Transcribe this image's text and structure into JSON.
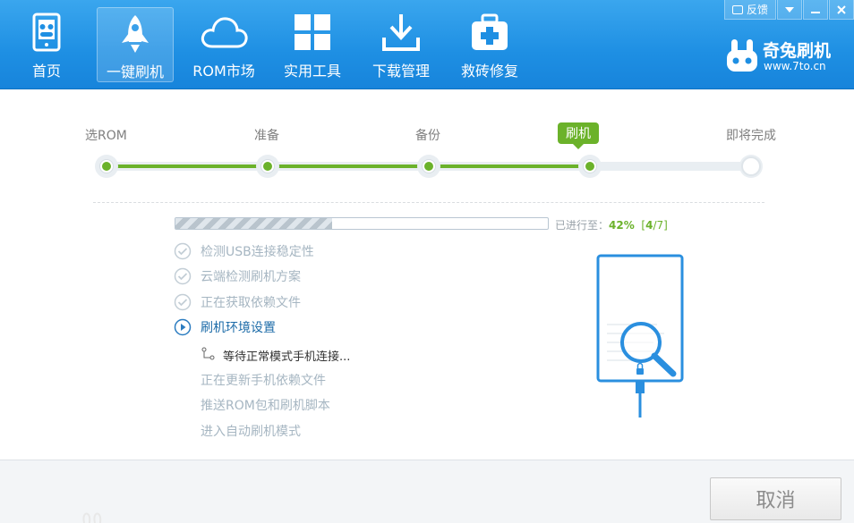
{
  "nav": {
    "items": [
      {
        "label": "首页",
        "icon": "home-icon"
      },
      {
        "label": "一键刷机",
        "icon": "rocket-icon",
        "active": true
      },
      {
        "label": "ROM市场",
        "icon": "cloud-icon"
      },
      {
        "label": "实用工具",
        "icon": "grid-icon"
      },
      {
        "label": "下载管理",
        "icon": "download-icon"
      },
      {
        "label": "救砖修复",
        "icon": "medical-kit-icon"
      }
    ]
  },
  "window_controls": {
    "feedback_label": "反馈"
  },
  "brand": {
    "name": "奇兔刷机",
    "url": "www.7to.cn"
  },
  "steps": {
    "items": [
      {
        "label": "选ROM",
        "state": "done"
      },
      {
        "label": "准备",
        "state": "done"
      },
      {
        "label": "备份",
        "state": "done"
      },
      {
        "label": "刷机",
        "state": "current"
      },
      {
        "label": "即将完成",
        "state": "pending"
      }
    ]
  },
  "progress": {
    "prefix": "已进行至：",
    "percent_text": "42%",
    "value": 0.42,
    "count_open": "[",
    "count_current": "4",
    "count_sep": "/",
    "count_total": "7",
    "count_close": "]"
  },
  "tasks": [
    {
      "label": "检测USB连接稳定性",
      "state": "done"
    },
    {
      "label": "云端检测刷机方案",
      "state": "done"
    },
    {
      "label": "正在获取依赖文件",
      "state": "done"
    },
    {
      "label": "刷机环境设置",
      "state": "active"
    },
    {
      "label": "正在更新手机依赖文件",
      "state": "pending"
    },
    {
      "label": "推送ROM包和刷机脚本",
      "state": "pending"
    },
    {
      "label": "进入自动刷机模式",
      "state": "pending"
    }
  ],
  "subtask": {
    "label": "等待正常模式手机连接..."
  },
  "footer": {
    "cancel_label": "取消"
  },
  "colors": {
    "header_blue": "#1e8fe3",
    "accent_green": "#6bb22a",
    "active_text": "#1c6ba8",
    "muted_text": "#a6b6c2"
  }
}
